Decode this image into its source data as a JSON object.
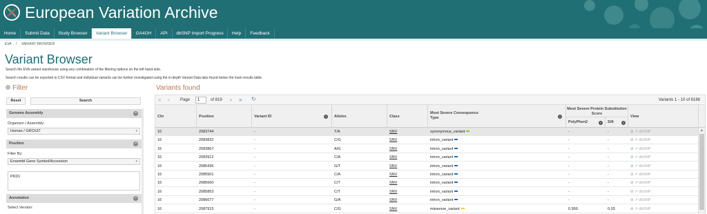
{
  "header": {
    "title": "European Variation Archive"
  },
  "nav": {
    "tabs": [
      {
        "label": "Home",
        "active": false
      },
      {
        "label": "Submit Data",
        "active": false
      },
      {
        "label": "Study Browser",
        "active": false
      },
      {
        "label": "Variant Browser",
        "active": true
      },
      {
        "label": "GA4GH",
        "active": false
      },
      {
        "label": "API",
        "active": false
      },
      {
        "label": "dbSNP Import Progress",
        "active": false
      },
      {
        "label": "Help",
        "active": false
      },
      {
        "label": "Feedback",
        "active": false
      }
    ]
  },
  "breadcrumb": [
    "EVA",
    "/",
    "VARIANT BROWSER"
  ],
  "page": {
    "title": "Variant Browser",
    "desc1": "Search the EVA variant warehouse using any combination of the filtering options on the left hand-side.",
    "desc2": "Search results can be exported in CSV format and individual variants can be further investigated using the in-depth Variant Data tabs found below the main results table."
  },
  "filter": {
    "title": "Filter",
    "reset_label": "Reset",
    "search_label": "Search",
    "genome_assembly": {
      "header": "Genome Assembly",
      "label": "Organism / Assembly:",
      "value": "Human / GRCh37"
    },
    "position": {
      "header": "Position",
      "label": "Filter By:",
      "value": "Ensembl Gene Symbol/Accession",
      "text": "PKD1"
    },
    "annotation": {
      "header": "Annotation",
      "label": "Select Version:"
    }
  },
  "variants": {
    "title": "Variants found",
    "pager": {
      "page_label": "Page",
      "page_value": "1",
      "of_label": "of 819",
      "info": "Variants 1 - 10 of 8186"
    },
    "columns": {
      "chr": "Chr",
      "position": "Position",
      "variant_id": "Variant ID",
      "alleles": "Alleles",
      "class": "Class",
      "consequence": "Most Severe Consequence Type",
      "protein_group": "Most Severe Protein Substitution Score",
      "polyphen": "PolyPhen2",
      "sift": "Sift",
      "view": "View"
    },
    "view_db_label": "dbSNP",
    "rows": [
      {
        "chr": "16",
        "position": "2083744",
        "variant_id": "-",
        "alleles": "T/A",
        "class": "SNV",
        "consequence": "synonymous_variant",
        "sev_color": "#7dd21a",
        "polyphen": "-",
        "sift": "-"
      },
      {
        "chr": "16",
        "position": "2083832",
        "variant_id": "-",
        "alleles": "C/G",
        "class": "SNV",
        "consequence": "intron_variant",
        "sev_color": "#1b6cb8",
        "polyphen": "-",
        "sift": "-"
      },
      {
        "chr": "16",
        "position": "2083867",
        "variant_id": "-",
        "alleles": "A/G",
        "class": "SNV",
        "consequence": "intron_variant",
        "sev_color": "#1b6cb8",
        "polyphen": "-",
        "sift": "-"
      },
      {
        "chr": "16",
        "position": "2083912",
        "variant_id": "-",
        "alleles": "C/A",
        "class": "SNV",
        "consequence": "intron_variant",
        "sev_color": "#1b6cb8",
        "polyphen": "-",
        "sift": "-"
      },
      {
        "chr": "16",
        "position": "2085436",
        "variant_id": "-",
        "alleles": "G/T",
        "class": "SNV",
        "consequence": "intron_variant",
        "sev_color": "#1b6cb8",
        "polyphen": "-",
        "sift": "-"
      },
      {
        "chr": "16",
        "position": "2085501",
        "variant_id": "-",
        "alleles": "C/A",
        "class": "SNV",
        "consequence": "intron_variant",
        "sev_color": "#1b6cb8",
        "polyphen": "-",
        "sift": "-"
      },
      {
        "chr": "16",
        "position": "2085660",
        "variant_id": "-",
        "alleles": "C/T",
        "class": "SNV",
        "consequence": "intron_variant",
        "sev_color": "#1b6cb8",
        "polyphen": "-",
        "sift": "-"
      },
      {
        "chr": "16",
        "position": "2085853",
        "variant_id": "-",
        "alleles": "C/T",
        "class": "SNV",
        "consequence": "intron_variant",
        "sev_color": "#1b6cb8",
        "polyphen": "-",
        "sift": "-"
      },
      {
        "chr": "16",
        "position": "2086677",
        "variant_id": "-",
        "alleles": "G/A",
        "class": "SNV",
        "consequence": "intron_variant",
        "sev_color": "#1b6cb8",
        "polyphen": "-",
        "sift": "-"
      },
      {
        "chr": "16",
        "position": "2087915",
        "variant_id": "-",
        "alleles": "C/G",
        "class": "SNV",
        "consequence": "missense_variant",
        "sev_color": "#f2d21e",
        "polyphen": "0.999",
        "sift": "0.03"
      }
    ]
  },
  "colors": {
    "brand": "#1f6f74",
    "heading": "#1a6f76",
    "accent": "#b07a5c"
  }
}
